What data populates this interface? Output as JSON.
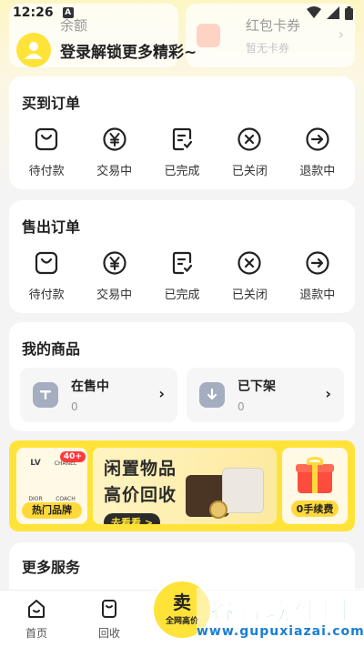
{
  "status_bar": {
    "time": "12:26",
    "badge": "A"
  },
  "wallet": {
    "balance_title": "余额",
    "coupon_title": "红包卡券",
    "coupon_sub": "暂无卡券"
  },
  "login": {
    "prompt": "登录解锁更多精彩~"
  },
  "bought_orders": {
    "title": "买到订单",
    "items": [
      {
        "label": "待付款",
        "icon": "wallet-icon"
      },
      {
        "label": "交易中",
        "icon": "yen-icon"
      },
      {
        "label": "已完成",
        "icon": "check-doc-icon"
      },
      {
        "label": "已关闭",
        "icon": "close-circle-icon"
      },
      {
        "label": "退款中",
        "icon": "arrow-right-circle-icon"
      }
    ]
  },
  "sold_orders": {
    "title": "售出订单",
    "items": [
      {
        "label": "待付款",
        "icon": "wallet-icon"
      },
      {
        "label": "交易中",
        "icon": "yen-icon"
      },
      {
        "label": "已完成",
        "icon": "check-doc-icon"
      },
      {
        "label": "已关闭",
        "icon": "close-circle-icon"
      },
      {
        "label": "退款中",
        "icon": "arrow-right-circle-icon"
      }
    ]
  },
  "my_goods": {
    "title": "我的商品",
    "on_sale": {
      "label": "在售中",
      "count": "0"
    },
    "off_shelf": {
      "label": "已下架",
      "count": "0"
    }
  },
  "banner": {
    "brand_badge": "40+",
    "brand_label": "热门品牌",
    "brand_logos": [
      "LV",
      "CHANEL",
      "DIOR",
      "COACH"
    ],
    "main_line1": "闲置物品",
    "main_line2": "高价回收",
    "main_cta": "去看看 >",
    "fee_label": "0手续费"
  },
  "more_services": {
    "title": "更多服务"
  },
  "tabbar": {
    "home": "首页",
    "recycle": "回收",
    "sell_line1": "卖",
    "sell_line2": "全网高价"
  },
  "watermark": {
    "line1": "谷普软件园",
    "line2": "www.gupuxiazai.com"
  },
  "colors": {
    "accent": "#ffe339",
    "watermark_green": "#19a33b",
    "watermark_blue": "#1a7fd1"
  }
}
